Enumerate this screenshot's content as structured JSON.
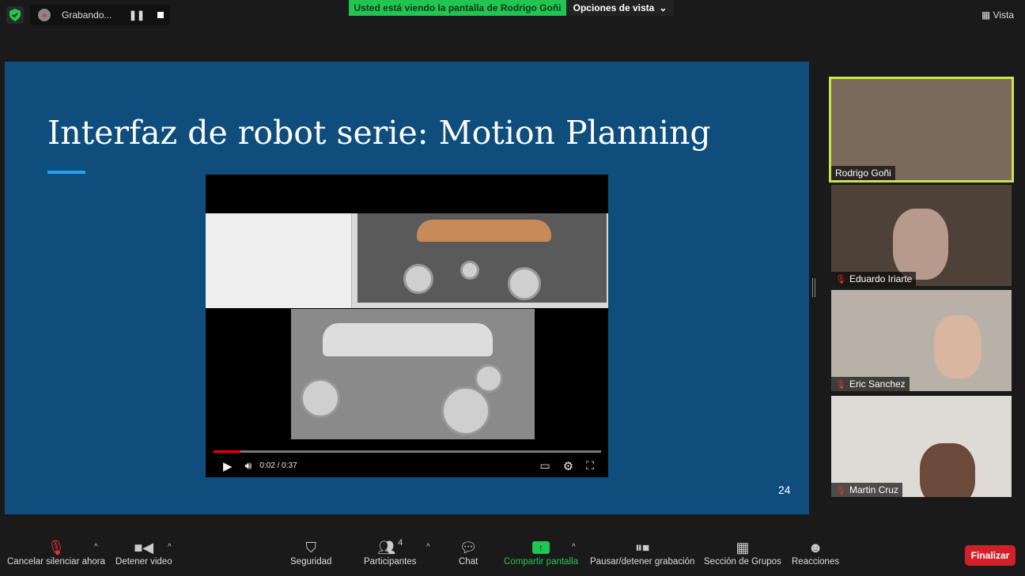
{
  "top": {
    "recording": "Grabando...",
    "banner": "Usted está viendo la pantalla de Rodrigo Goñi",
    "view_options": "Opciones de vista",
    "view": "Vista"
  },
  "slide": {
    "title": "Interfaz de robot serie: Motion Planning",
    "page": "24",
    "accent": "#1ca2e8",
    "background": "#0e4d7c"
  },
  "video": {
    "time": "0:02 / 0:37",
    "progress_percent": 7
  },
  "participants": [
    {
      "name": "Rodrigo Goñi",
      "muted": false,
      "active": true
    },
    {
      "name": "Eduardo Iriarte",
      "muted": true
    },
    {
      "name": "Eric Sanchez",
      "muted": true
    },
    {
      "name": "Martin Cruz",
      "muted": true
    }
  ],
  "toolbar": {
    "unmute": "Cancelar silenciar ahora",
    "video": "Detener video",
    "security": "Seguridad",
    "participants": "Participantes",
    "participants_count": "4",
    "chat": "Chat",
    "share": "Compartir pantalla",
    "record": "Pausar/detener grabación",
    "breakout": "Sección de Grupos",
    "reactions": "Reacciones",
    "end": "Finalizar"
  }
}
